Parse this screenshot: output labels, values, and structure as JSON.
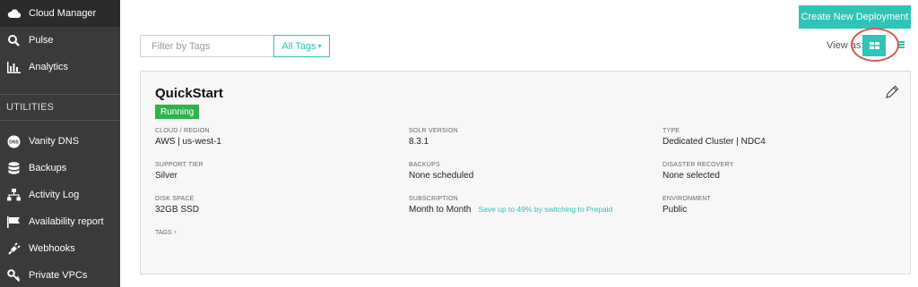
{
  "sidebar": {
    "items": [
      {
        "label": "Cloud Manager",
        "icon": "cloud-icon"
      },
      {
        "label": "Pulse",
        "icon": "search-icon"
      },
      {
        "label": "Analytics",
        "icon": "bar-chart-icon"
      }
    ],
    "section_label": "UTILITIES",
    "utility_items": [
      {
        "label": "Vanity DNS",
        "icon": "dns-icon",
        "icon_text": "DNS"
      },
      {
        "label": "Backups",
        "icon": "database-icon"
      },
      {
        "label": "Activity Log",
        "icon": "sitemap-icon"
      },
      {
        "label": "Availability report",
        "icon": "flag-icon"
      },
      {
        "label": "Webhooks",
        "icon": "plug-icon"
      },
      {
        "label": "Private VPCs",
        "icon": "key-icon"
      }
    ]
  },
  "toolbar": {
    "create_label": "Create New Deployment",
    "filter_placeholder": "Filter by Tags",
    "tags_label": "All Tags",
    "view_as_label": "View as:"
  },
  "deployment": {
    "name": "QuickStart",
    "status": "Running",
    "fields": {
      "cloud_region": {
        "label": "CLOUD / REGION",
        "value": "AWS | us-west-1"
      },
      "solr_version": {
        "label": "SOLR VERSION",
        "value": "8.3.1"
      },
      "type": {
        "label": "TYPE",
        "value": "Dedicated Cluster | NDC4"
      },
      "support_tier": {
        "label": "SUPPORT TIER",
        "value": "Silver"
      },
      "backups": {
        "label": "BACKUPS",
        "value": "None scheduled"
      },
      "disaster_recovery": {
        "label": "DISASTER RECOVERY",
        "value": "None selected"
      },
      "disk_space": {
        "label": "DISK SPACE",
        "value": "32GB SSD"
      },
      "subscription": {
        "label": "SUBSCRIPTION",
        "value": "Month to Month",
        "promo": "Save up to 49% by switching to Prepaid"
      },
      "environment": {
        "label": "ENVIRONMENT",
        "value": "Public"
      }
    },
    "tags_label": "TAGS",
    "tags_add": "+"
  },
  "colors": {
    "accent": "#2ec4b6",
    "running": "#2fb34a",
    "sidebar_bg": "#3a3a3a",
    "highlight": "#d9534f"
  }
}
